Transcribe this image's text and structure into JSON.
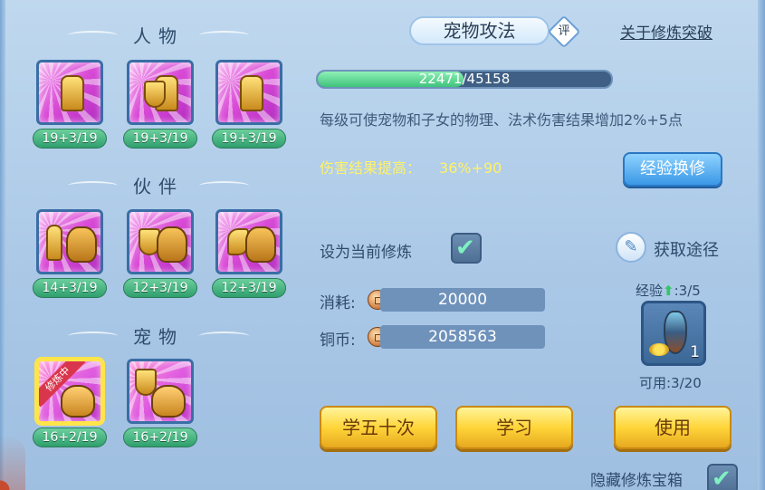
{
  "sections": {
    "characters": "人物",
    "partners": "伙伴",
    "pets": "宠物"
  },
  "skills": {
    "characters": [
      {
        "level": "19+3/19"
      },
      {
        "level": "19+3/19"
      },
      {
        "level": "19+3/19"
      }
    ],
    "partners": [
      {
        "level": "14+3/19"
      },
      {
        "level": "12+3/19"
      },
      {
        "level": "12+3/19"
      }
    ],
    "pets": [
      {
        "level": "16+2/19",
        "badge": "修炼中"
      },
      {
        "level": "16+2/19"
      }
    ]
  },
  "detail": {
    "title": "宠物攻法",
    "rate_label": "评",
    "breakthrough_link": "关于修炼突破",
    "exp_current": "22471",
    "exp_total": "/45158",
    "exp_fraction": 0.498,
    "description": "每级可使宠物和子女的物理、法术伤害结果增加2%+5点",
    "damage_label": "伤害结果提高：",
    "damage_value": "36%+90",
    "exchange_button": "经验换修",
    "set_current_label": "设为当前修炼",
    "source_label": "获取途径",
    "cost_label": "消耗:",
    "cost_value": "20000",
    "copper_label": "铜币:",
    "copper_value": "2058563",
    "exp_item_label_prefix": "经验",
    "exp_item_label_suffix": ":3/5",
    "item_count": "1",
    "available_label": "可用:3/20",
    "btn_learn50": "学五十次",
    "btn_learn": "学习",
    "btn_use": "使用",
    "hide_box_label": "隐藏修炼宝箱"
  },
  "colors": {
    "accent_green": "#3fc27c",
    "highlight_yellow": "#fff267",
    "button_gold": "#ffd53a",
    "button_blue": "#3a98e6"
  }
}
